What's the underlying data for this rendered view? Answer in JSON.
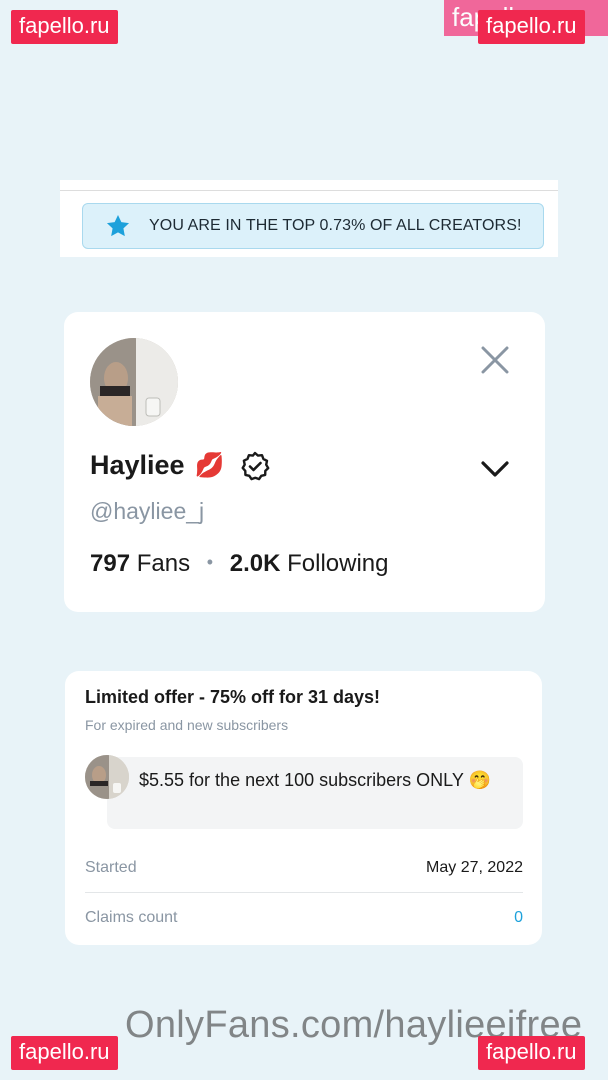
{
  "watermarks": {
    "site_label": "fapello.ru",
    "footer_text": "OnlyFans.com/haylieeifree"
  },
  "banner": {
    "text": "YOU ARE IN THE TOP 0.73% OF ALL CREATORS!",
    "icon": "star-icon",
    "accent": "#1da1db"
  },
  "profile": {
    "name": "Hayliee",
    "name_emoji": "💋",
    "handle": "@hayliee_j",
    "fans_count": "797",
    "fans_label": "Fans",
    "following_count": "2.0K",
    "following_label": "Following",
    "icons": [
      "avatar",
      "verified-badge-icon",
      "close-icon",
      "chevron-down-icon"
    ]
  },
  "offer": {
    "title": "Limited offer - 75% off for 31 days!",
    "subtitle": "For expired and new subscribers",
    "message": "$5.55 for the next 100 subscribers ONLY 🤭",
    "started_label": "Started",
    "started_value": "May 27, 2022",
    "claims_label": "Claims count",
    "claims_value": "0"
  }
}
